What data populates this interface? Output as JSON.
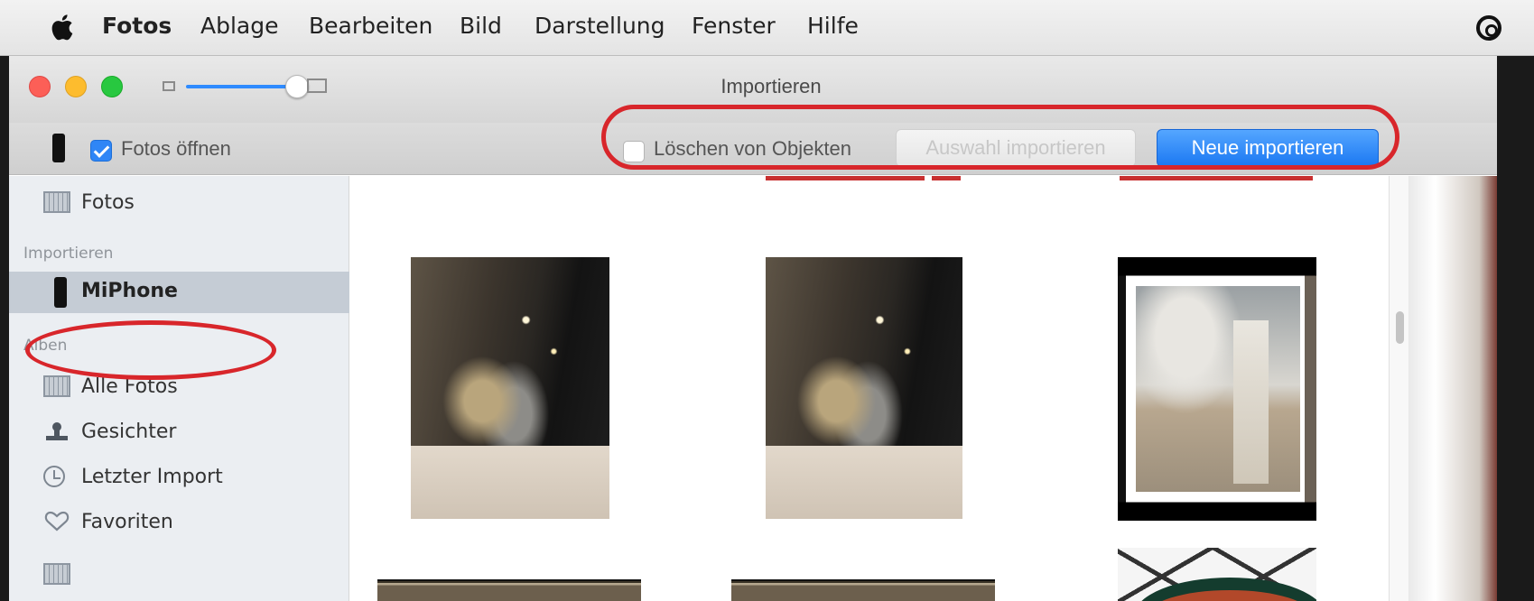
{
  "menubar": {
    "app_name": "Fotos",
    "items": [
      "Ablage",
      "Bearbeiten",
      "Bild",
      "Darstellung",
      "Fenster",
      "Hilfe"
    ]
  },
  "window": {
    "title": "Importieren"
  },
  "toolbar": {
    "open_photos_label": "Fotos öffnen",
    "open_photos_checked": true,
    "delete_items_label": "Löschen von Objekten",
    "delete_items_checked": false,
    "import_selected_label": "Auswahl importieren",
    "import_new_label": "Neue importieren"
  },
  "sidebar": {
    "top_item": "Fotos",
    "import_header": "Importieren",
    "device_item": "MiPhone",
    "albums_header": "Alben",
    "albums": [
      "Alle Fotos",
      "Gesichter",
      "Letzter Import",
      "Favoriten"
    ]
  },
  "colors": {
    "accent_blue": "#1b78f2",
    "annotation_red": "#d8262b",
    "sidebar_bg": "#ebeef2",
    "sidebar_selected": "#c5ccd5"
  },
  "icons": [
    "apple-logo",
    "control-center-icon",
    "device-phone-icon",
    "photos-grid-icon",
    "faces-icon",
    "clock-icon",
    "heart-icon"
  ]
}
